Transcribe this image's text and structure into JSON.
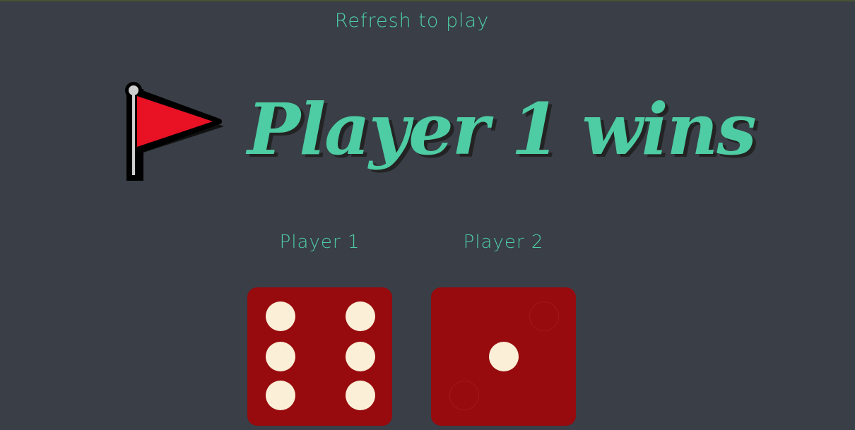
{
  "header": {
    "refresh_text": "Refresh to play"
  },
  "result": {
    "flag_icon": "red-flag-icon",
    "title": "Player 1 wins"
  },
  "players": [
    {
      "label": "Player 1",
      "die_value": 6
    },
    {
      "label": "Player 2",
      "die_value": 1
    }
  ],
  "colors": {
    "background": "#393e47",
    "accent": "#4ecca3",
    "die": "#970a0d",
    "pip": "#fbefd8",
    "flag": "#e81224"
  }
}
